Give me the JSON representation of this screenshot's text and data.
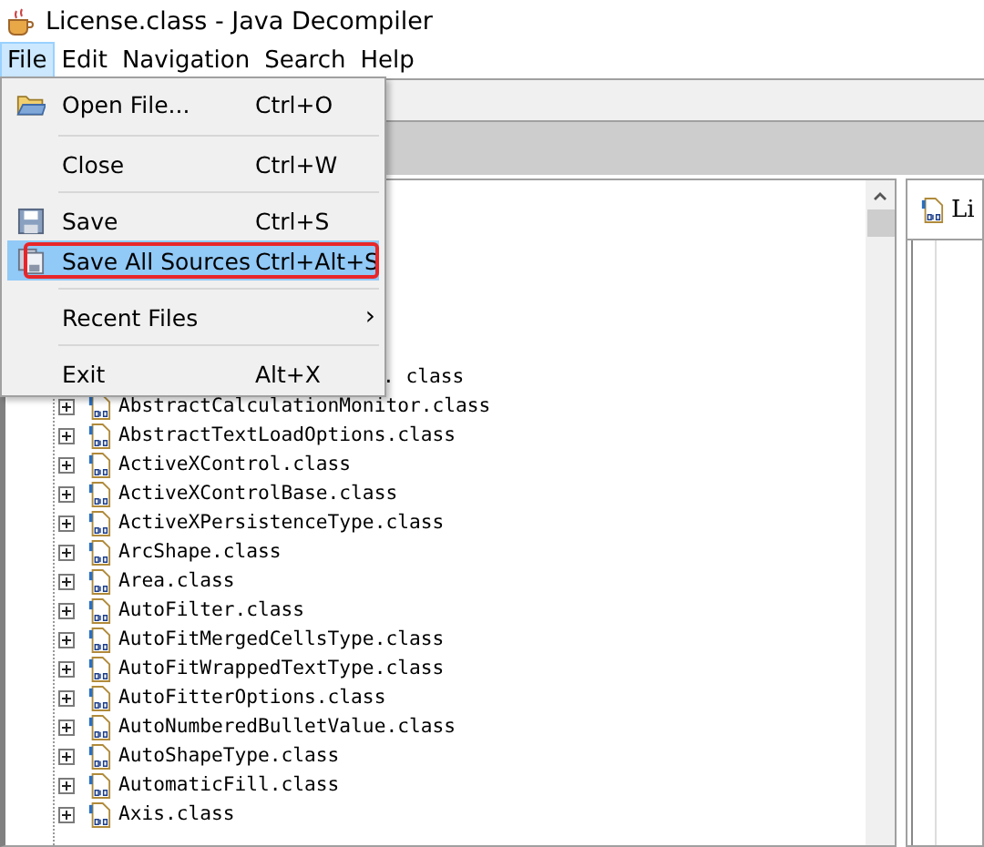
{
  "window": {
    "title": "License.class - Java Decompiler"
  },
  "menubar": [
    {
      "label": "File",
      "selected": true
    },
    {
      "label": "Edit",
      "selected": false
    },
    {
      "label": "Navigation",
      "selected": false
    },
    {
      "label": "Search",
      "selected": false
    },
    {
      "label": "Help",
      "selected": false
    }
  ],
  "file_menu": [
    {
      "kind": "item",
      "label": "Open File...",
      "shortcut": "Ctrl+O",
      "selected": false,
      "outlined": false
    },
    {
      "kind": "separator"
    },
    {
      "kind": "item",
      "label": "Close",
      "shortcut": "Ctrl+W",
      "selected": false,
      "outlined": false
    },
    {
      "kind": "separator"
    },
    {
      "kind": "item",
      "label": "Save",
      "shortcut": "Ctrl+S",
      "selected": false,
      "outlined": false
    },
    {
      "kind": "item",
      "label": "Save All Sources",
      "shortcut": "Ctrl+Alt+S",
      "selected": true,
      "outlined": true
    },
    {
      "kind": "separator"
    },
    {
      "kind": "submenu",
      "label": "Recent Files",
      "arrow": "›",
      "selected": false,
      "outlined": false
    },
    {
      "kind": "separator"
    },
    {
      "kind": "item",
      "label": "Exit",
      "shortcut": "Alt+X",
      "selected": false,
      "outlined": false
    }
  ],
  "tree": [
    {
      "kind": "clipped",
      "label": ". class"
    },
    {
      "kind": "class",
      "label": "AbstractCalculationMonitor.class"
    },
    {
      "kind": "class",
      "label": "AbstractTextLoadOptions.class"
    },
    {
      "kind": "class",
      "label": "ActiveXControl.class"
    },
    {
      "kind": "class",
      "label": "ActiveXControlBase.class"
    },
    {
      "kind": "class",
      "label": "ActiveXPersistenceType.class"
    },
    {
      "kind": "class",
      "label": "ArcShape.class"
    },
    {
      "kind": "class",
      "label": "Area.class"
    },
    {
      "kind": "class",
      "label": "AutoFilter.class"
    },
    {
      "kind": "class",
      "label": "AutoFitMergedCellsType.class"
    },
    {
      "kind": "class",
      "label": "AutoFitWrappedTextType.class"
    },
    {
      "kind": "class",
      "label": "AutoFitterOptions.class"
    },
    {
      "kind": "class",
      "label": "AutoNumberedBulletValue.class"
    },
    {
      "kind": "class",
      "label": "AutoShapeType.class"
    },
    {
      "kind": "class",
      "label": "AutomaticFill.class"
    },
    {
      "kind": "class",
      "label": "Axis.class"
    }
  ],
  "editor_tab": {
    "label": "Li"
  }
}
